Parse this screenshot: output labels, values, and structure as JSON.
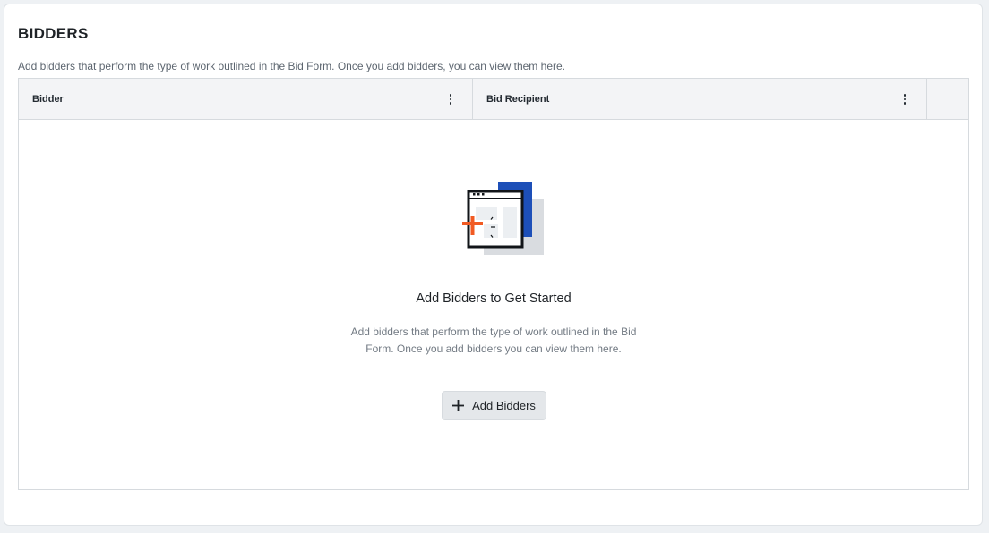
{
  "section": {
    "title": "BIDDERS",
    "subtitle": "Add bidders that perform the type of work outlined in the Bid Form. Once you add bidders, you can view them here."
  },
  "table": {
    "columns": [
      {
        "label": "Bidder",
        "menu_icon": "kebab-menu-icon"
      },
      {
        "label": "Bid Recipient",
        "menu_icon": "kebab-menu-icon"
      }
    ]
  },
  "empty_state": {
    "illustration_icon": "add-window-illustration-icon",
    "title": "Add Bidders to Get Started",
    "description": "Add bidders that perform the type of work outlined in the Bid Form. Once you add bidders you can view them here.",
    "button_label": "Add Bidders",
    "button_icon": "plus-icon"
  },
  "colors": {
    "accent_blue": "#1d4fb8",
    "accent_orange": "#f15a22"
  }
}
